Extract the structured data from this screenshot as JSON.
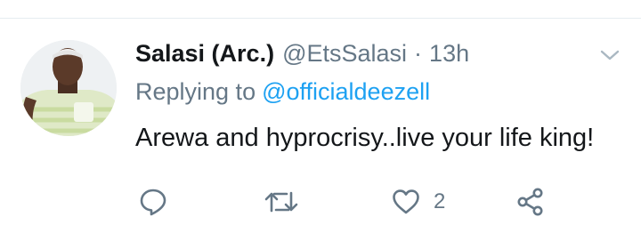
{
  "tweet": {
    "display_name": "Salasi (Arc.)",
    "handle": "@EtsSalasi",
    "separator": "·",
    "time": "13h",
    "replying_label": "Replying to",
    "replying_to": "@officialdeezell",
    "text": "Arewa and hyprocrisy..live your life king!"
  },
  "actions": {
    "reply_icon": "reply-icon",
    "retweet_icon": "retweet-icon",
    "like_icon": "heart-icon",
    "like_count": "2",
    "share_icon": "share-icon"
  },
  "icons": {
    "more_menu": "chevron-down-icon"
  },
  "colors": {
    "primary_text": "#14171a",
    "secondary_text": "#657786",
    "link": "#1da1f2",
    "icon_gray": "#657786",
    "divider": "#e6ecf0"
  }
}
